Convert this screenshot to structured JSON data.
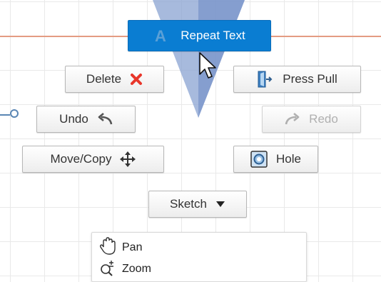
{
  "marking_menu": {
    "repeat_label": "Repeat Text",
    "delete_label": "Delete",
    "press_pull_label": "Press Pull",
    "undo_label": "Undo",
    "redo_label": "Redo",
    "move_copy_label": "Move/Copy",
    "hole_label": "Hole",
    "sketch_label": "Sketch"
  },
  "submenu": {
    "items": [
      {
        "label": "Pan",
        "icon": "hand-icon"
      },
      {
        "label": "Zoom",
        "icon": "zoom-icon"
      }
    ]
  },
  "colors": {
    "accent": "#0a7dd2",
    "delete_red": "#e8362a",
    "axis_line": "#e49c83",
    "origin_blue": "#5a86b4"
  }
}
